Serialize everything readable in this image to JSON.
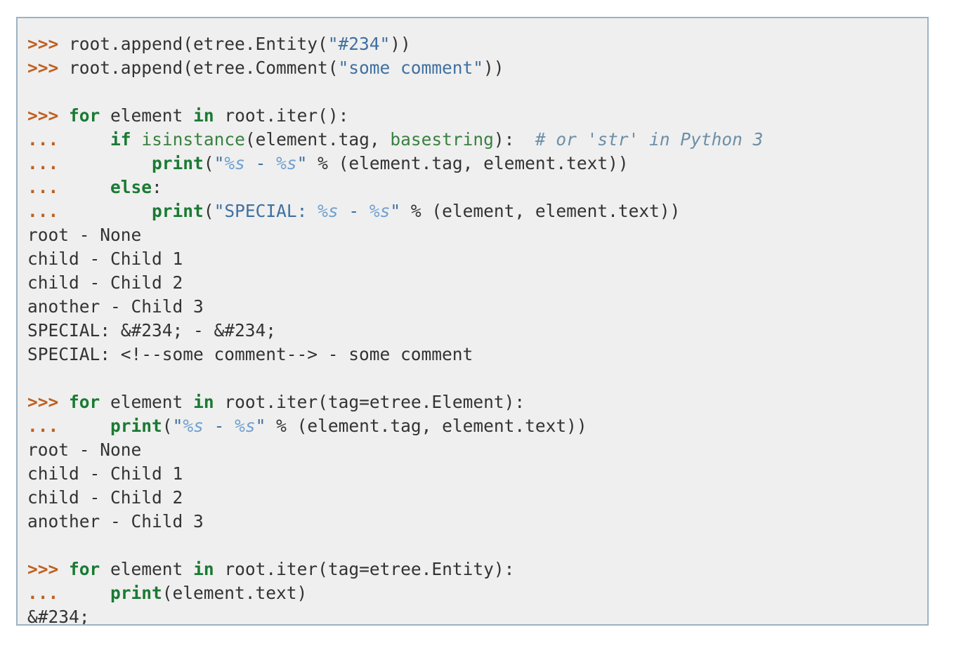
{
  "page": {
    "background": "#ffffff",
    "block_background": "#efefef",
    "block_border_color": "#9db2c3"
  },
  "colors": {
    "prompt": "#c05f1e",
    "continuation": "#c05f1e",
    "keyword": "#1a7a33",
    "builtin": "#3a8040",
    "string": "#4070a0",
    "string_interpolation": "#70a0d0",
    "comment": "#6c8fa8",
    "plain": "#333333",
    "output": "#333333"
  },
  "code_block": {
    "language": "python-doctest",
    "lines": [
      {
        "type": "input",
        "text": ">>> root.append(etree.Entity(\"#234\"))",
        "tokens": [
          {
            "cls": "t-prompt",
            "text": ">>>"
          },
          {
            "cls": "t-plain",
            "text": " root.append(etree.Entity("
          },
          {
            "cls": "t-str",
            "text": "\"#234\""
          },
          {
            "cls": "t-plain",
            "text": "))"
          }
        ]
      },
      {
        "type": "input",
        "text": ">>> root.append(etree.Comment(\"some comment\"))",
        "tokens": [
          {
            "cls": "t-prompt",
            "text": ">>>"
          },
          {
            "cls": "t-plain",
            "text": " root.append(etree.Comment("
          },
          {
            "cls": "t-str",
            "text": "\"some comment\""
          },
          {
            "cls": "t-plain",
            "text": "))"
          }
        ]
      },
      {
        "type": "blank",
        "text": "",
        "tokens": []
      },
      {
        "type": "input",
        "text": ">>> for element in root.iter():",
        "tokens": [
          {
            "cls": "t-prompt",
            "text": ">>>"
          },
          {
            "cls": "t-plain",
            "text": " "
          },
          {
            "cls": "t-kw",
            "text": "for"
          },
          {
            "cls": "t-plain",
            "text": " element "
          },
          {
            "cls": "t-kw",
            "text": "in"
          },
          {
            "cls": "t-plain",
            "text": " root.iter():"
          }
        ]
      },
      {
        "type": "continuation",
        "text": "...     if isinstance(element.tag, basestring):  # or 'str' in Python 3",
        "tokens": [
          {
            "cls": "t-cont",
            "text": "..."
          },
          {
            "cls": "t-plain",
            "text": "     "
          },
          {
            "cls": "t-kw",
            "text": "if"
          },
          {
            "cls": "t-plain",
            "text": " "
          },
          {
            "cls": "t-builtin",
            "text": "isinstance"
          },
          {
            "cls": "t-plain",
            "text": "(element.tag, "
          },
          {
            "cls": "t-builtin",
            "text": "basestring"
          },
          {
            "cls": "t-plain",
            "text": "):  "
          },
          {
            "cls": "t-comment",
            "text": "# or 'str' in Python 3"
          }
        ]
      },
      {
        "type": "continuation",
        "text": "...         print(\"%s - %s\" % (element.tag, element.text))",
        "tokens": [
          {
            "cls": "t-cont",
            "text": "..."
          },
          {
            "cls": "t-plain",
            "text": "         "
          },
          {
            "cls": "t-kw",
            "text": "print"
          },
          {
            "cls": "t-plain",
            "text": "("
          },
          {
            "cls": "t-str",
            "text": "\""
          },
          {
            "cls": "t-interp",
            "text": "%s"
          },
          {
            "cls": "t-str",
            "text": " - "
          },
          {
            "cls": "t-interp",
            "text": "%s"
          },
          {
            "cls": "t-str",
            "text": "\""
          },
          {
            "cls": "t-plain",
            "text": " % (element.tag, element.text))"
          }
        ]
      },
      {
        "type": "continuation",
        "text": "...     else:",
        "tokens": [
          {
            "cls": "t-cont",
            "text": "..."
          },
          {
            "cls": "t-plain",
            "text": "     "
          },
          {
            "cls": "t-kw",
            "text": "else"
          },
          {
            "cls": "t-plain",
            "text": ":"
          }
        ]
      },
      {
        "type": "continuation",
        "text": "...         print(\"SPECIAL: %s - %s\" % (element, element.text))",
        "tokens": [
          {
            "cls": "t-cont",
            "text": "..."
          },
          {
            "cls": "t-plain",
            "text": "         "
          },
          {
            "cls": "t-kw",
            "text": "print"
          },
          {
            "cls": "t-plain",
            "text": "("
          },
          {
            "cls": "t-str",
            "text": "\"SPECIAL: "
          },
          {
            "cls": "t-interp",
            "text": "%s"
          },
          {
            "cls": "t-str",
            "text": " - "
          },
          {
            "cls": "t-interp",
            "text": "%s"
          },
          {
            "cls": "t-str",
            "text": "\""
          },
          {
            "cls": "t-plain",
            "text": " % (element, element.text))"
          }
        ]
      },
      {
        "type": "output",
        "text": "root - None",
        "tokens": [
          {
            "cls": "t-out",
            "text": "root - None"
          }
        ]
      },
      {
        "type": "output",
        "text": "child - Child 1",
        "tokens": [
          {
            "cls": "t-out",
            "text": "child - Child 1"
          }
        ]
      },
      {
        "type": "output",
        "text": "child - Child 2",
        "tokens": [
          {
            "cls": "t-out",
            "text": "child - Child 2"
          }
        ]
      },
      {
        "type": "output",
        "text": "another - Child 3",
        "tokens": [
          {
            "cls": "t-out",
            "text": "another - Child 3"
          }
        ]
      },
      {
        "type": "output",
        "text": "SPECIAL: &#234; - &#234;",
        "tokens": [
          {
            "cls": "t-out",
            "text": "SPECIAL: &#234; - &#234;"
          }
        ]
      },
      {
        "type": "output",
        "text": "SPECIAL: <!--some comment--> - some comment",
        "tokens": [
          {
            "cls": "t-out",
            "text": "SPECIAL: <!--some comment--> - some comment"
          }
        ]
      },
      {
        "type": "blank",
        "text": "",
        "tokens": []
      },
      {
        "type": "input",
        "text": ">>> for element in root.iter(tag=etree.Element):",
        "tokens": [
          {
            "cls": "t-prompt",
            "text": ">>>"
          },
          {
            "cls": "t-plain",
            "text": " "
          },
          {
            "cls": "t-kw",
            "text": "for"
          },
          {
            "cls": "t-plain",
            "text": " element "
          },
          {
            "cls": "t-kw",
            "text": "in"
          },
          {
            "cls": "t-plain",
            "text": " root.iter(tag=etree.Element):"
          }
        ]
      },
      {
        "type": "continuation",
        "text": "...     print(\"%s - %s\" % (element.tag, element.text))",
        "tokens": [
          {
            "cls": "t-cont",
            "text": "..."
          },
          {
            "cls": "t-plain",
            "text": "     "
          },
          {
            "cls": "t-kw",
            "text": "print"
          },
          {
            "cls": "t-plain",
            "text": "("
          },
          {
            "cls": "t-str",
            "text": "\""
          },
          {
            "cls": "t-interp",
            "text": "%s"
          },
          {
            "cls": "t-str",
            "text": " - "
          },
          {
            "cls": "t-interp",
            "text": "%s"
          },
          {
            "cls": "t-str",
            "text": "\""
          },
          {
            "cls": "t-plain",
            "text": " % (element.tag, element.text))"
          }
        ]
      },
      {
        "type": "output",
        "text": "root - None",
        "tokens": [
          {
            "cls": "t-out",
            "text": "root - None"
          }
        ]
      },
      {
        "type": "output",
        "text": "child - Child 1",
        "tokens": [
          {
            "cls": "t-out",
            "text": "child - Child 1"
          }
        ]
      },
      {
        "type": "output",
        "text": "child - Child 2",
        "tokens": [
          {
            "cls": "t-out",
            "text": "child - Child 2"
          }
        ]
      },
      {
        "type": "output",
        "text": "another - Child 3",
        "tokens": [
          {
            "cls": "t-out",
            "text": "another - Child 3"
          }
        ]
      },
      {
        "type": "blank",
        "text": "",
        "tokens": []
      },
      {
        "type": "input",
        "text": ">>> for element in root.iter(tag=etree.Entity):",
        "tokens": [
          {
            "cls": "t-prompt",
            "text": ">>>"
          },
          {
            "cls": "t-plain",
            "text": " "
          },
          {
            "cls": "t-kw",
            "text": "for"
          },
          {
            "cls": "t-plain",
            "text": " element "
          },
          {
            "cls": "t-kw",
            "text": "in"
          },
          {
            "cls": "t-plain",
            "text": " root.iter(tag=etree.Entity):"
          }
        ]
      },
      {
        "type": "continuation",
        "text": "...     print(element.text)",
        "tokens": [
          {
            "cls": "t-cont",
            "text": "..."
          },
          {
            "cls": "t-plain",
            "text": "     "
          },
          {
            "cls": "t-kw",
            "text": "print"
          },
          {
            "cls": "t-plain",
            "text": "(element.text)"
          }
        ]
      },
      {
        "type": "output",
        "text": "&#234;",
        "tokens": [
          {
            "cls": "t-out",
            "text": "&#234;"
          }
        ]
      }
    ]
  }
}
